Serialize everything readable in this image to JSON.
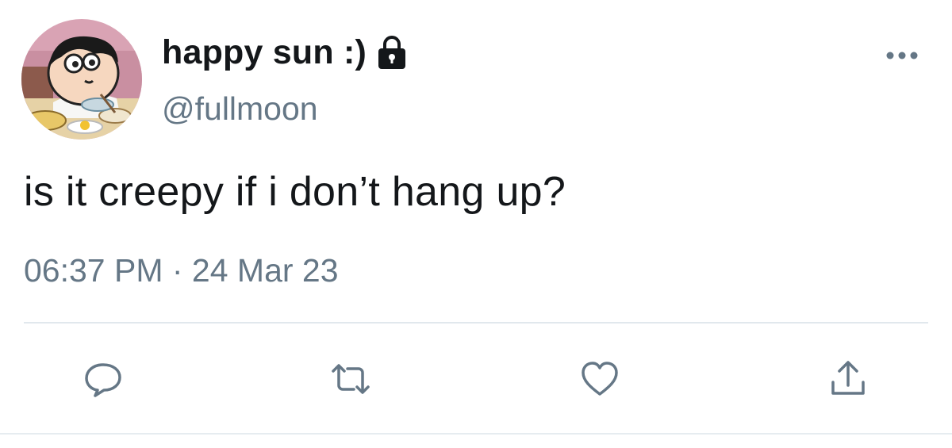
{
  "user": {
    "display_name": "happy sun :)",
    "handle": "@fullmoon",
    "protected_icon": "lock-icon",
    "avatar_icon": "cartoon-avatar"
  },
  "tweet": {
    "text": "is it creepy if i don’t hang up?",
    "timestamp": "06:37 PM · 24 Mar 23"
  },
  "actions": {
    "reply_icon": "reply-icon",
    "retweet_icon": "retweet-icon",
    "like_icon": "heart-icon",
    "share_icon": "share-icon",
    "more_icon": "more-icon"
  },
  "colors": {
    "text": "#14171a",
    "secondary": "#657786",
    "divider": "#e1e8ed"
  }
}
